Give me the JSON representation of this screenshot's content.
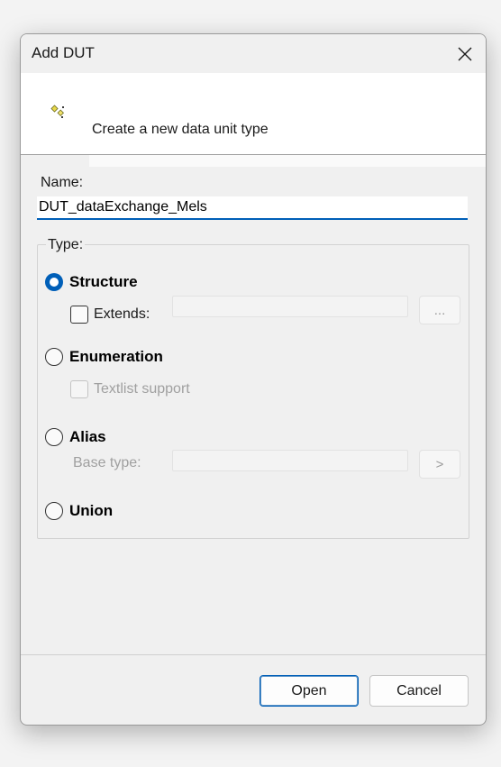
{
  "window": {
    "title": "Add DUT"
  },
  "header": {
    "description": "Create a new data unit type",
    "icon": "dut-wizard-icon"
  },
  "name_field": {
    "label": "Name:",
    "value": "DUT_dataExchange_Mels"
  },
  "type_group": {
    "legend": "Type:",
    "options": [
      {
        "label": "Structure",
        "checked": true
      },
      {
        "label": "Enumeration",
        "checked": false
      },
      {
        "label": "Alias",
        "checked": false
      },
      {
        "label": "Union",
        "checked": false
      }
    ],
    "extends": {
      "label": "Extends:",
      "checked": false,
      "browse_label": "..."
    },
    "textlist_support": {
      "label": "Textlist support",
      "checked": false,
      "enabled": false
    },
    "base_type": {
      "label": "Base type:",
      "browse_label": ">"
    }
  },
  "buttons": {
    "open": "Open",
    "cancel": "Cancel"
  },
  "colors": {
    "accent": "#005fb8",
    "background": "#f0f0f0",
    "header_band": "#ffffff"
  }
}
